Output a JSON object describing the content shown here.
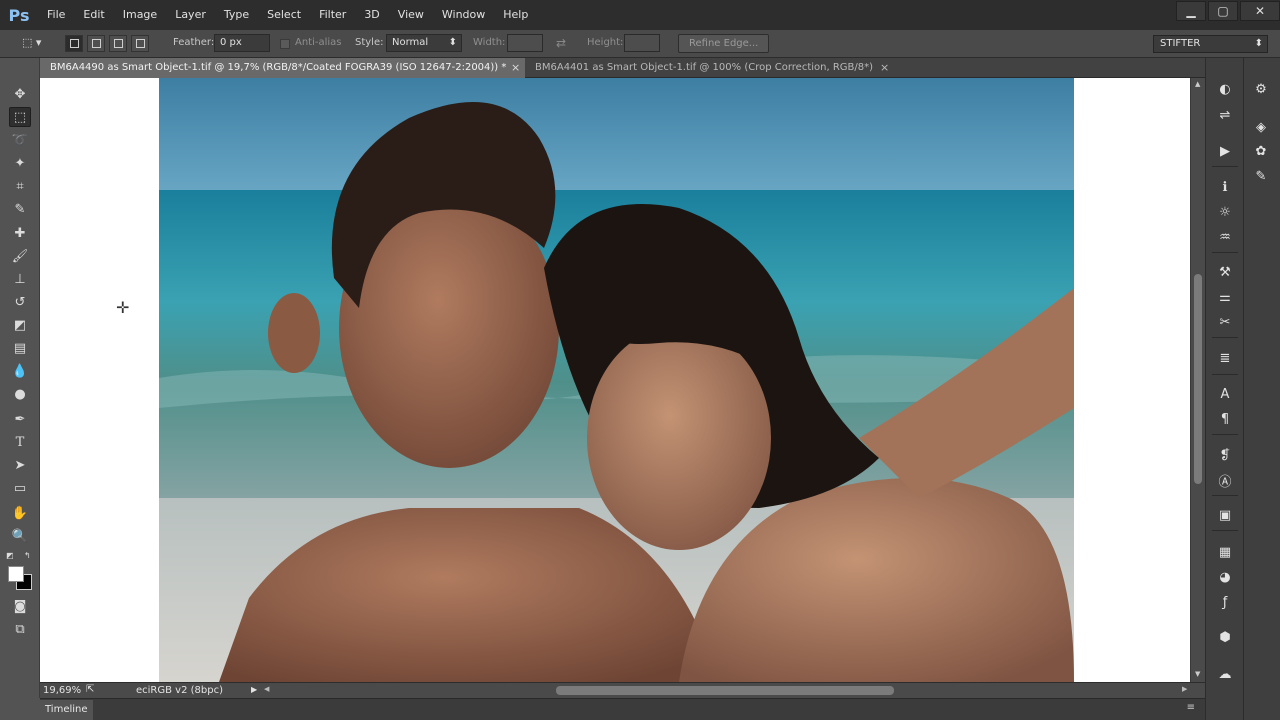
{
  "app": {
    "logo": "Ps"
  },
  "menu": [
    "File",
    "Edit",
    "Image",
    "Layer",
    "Type",
    "Select",
    "Filter",
    "3D",
    "View",
    "Window",
    "Help"
  ],
  "window_controls": {
    "minimize": "▁",
    "maximize": "▢",
    "close": "✕"
  },
  "options": {
    "feather_label": "Feather:",
    "feather_value": "0 px",
    "antialias_label": "Anti-alias",
    "style_label": "Style:",
    "style_value": "Normal",
    "width_label": "Width:",
    "height_label": "Height:",
    "refine_edge": "Refine Edge...",
    "workspace": "STIFTER"
  },
  "tabs": [
    {
      "label": "BM6A4490 as Smart Object-1.tif @ 19,7% (RGB/8*/Coated FOGRA39 (ISO 12647-2:2004)) *",
      "close": "×"
    },
    {
      "label": "BM6A4401 as Smart Object-1.tif @ 100% (Crop Correction, RGB/8*)",
      "close": "×"
    }
  ],
  "status": {
    "zoom": "19,69%",
    "profile": "eciRGB v2 (8bpc)"
  },
  "timeline": {
    "label": "Timeline"
  },
  "colors": {
    "accent_logo": "#8cc2f2",
    "chrome_dark": "#2d2d2d",
    "panel": "#535353"
  },
  "tools": [
    "move-icon",
    "rectangular-marquee-icon",
    "lasso-icon",
    "magic-wand-icon",
    "crop-icon",
    "eyedropper-icon",
    "healing-brush-icon",
    "brush-icon",
    "clone-stamp-icon",
    "history-brush-icon",
    "eraser-icon",
    "gradient-icon",
    "blur-icon",
    "dodge-icon",
    "pen-icon",
    "type-icon",
    "path-selection-icon",
    "rectangle-shape-icon",
    "hand-icon",
    "zoom-icon"
  ]
}
